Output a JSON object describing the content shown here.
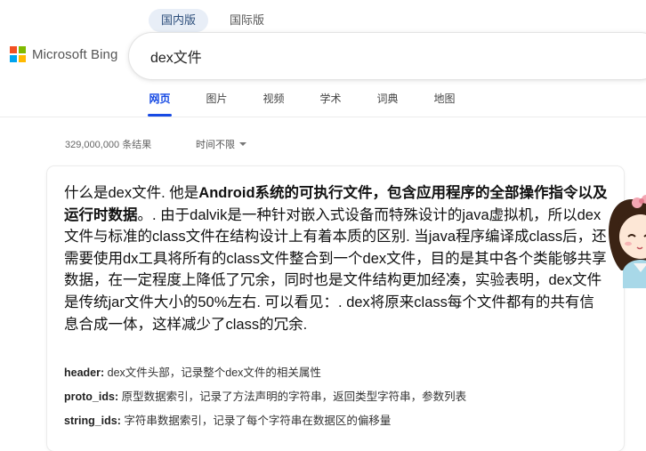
{
  "region_tabs": [
    {
      "label": "国内版",
      "active": true
    },
    {
      "label": "国际版",
      "active": false
    }
  ],
  "logo": {
    "text": "Microsoft Bing",
    "colors": [
      "#f25022",
      "#7fba00",
      "#00a4ef",
      "#ffb900"
    ]
  },
  "search": {
    "query": "dex文件"
  },
  "scopes": [
    {
      "label": "网页",
      "active": true
    },
    {
      "label": "图片",
      "active": false
    },
    {
      "label": "视频",
      "active": false
    },
    {
      "label": "学术",
      "active": false
    },
    {
      "label": "词典",
      "active": false
    },
    {
      "label": "地图",
      "active": false
    }
  ],
  "results_meta": {
    "count": "329,000,000 条结果",
    "time_filter": "时间不限"
  },
  "answer": {
    "part1": "什么是dex文件. 他是",
    "bold": "Android系统的可执行文件，包含应用程序的全部操作指令以及运行时数据",
    "part2": "。. 由于dalvik是一种针对嵌入式设备而特殊设计的java虚拟机，所以dex文件与标准的class文件在结构设计上有着本质的区别. 当java程序编译成class后，还需要使用dx工具将所有的class文件整合到一个dex文件，目的是其中各个类能够共享数据，在一定程度上降低了冗余，同时也是文件结构更加经凑，实验表明，dex文件是传统jar文件大小的50%左右. 可以看见：. dex将原来class每个文件都有的共有信息合成一体，这样减少了class的冗余."
  },
  "facts": [
    {
      "key": "header:",
      "value": " dex文件头部，记录整个dex文件的相关属性"
    },
    {
      "key": "proto_ids:",
      "value": " 原型数据索引，记录了方法声明的字符串，返回类型字符串，参数列表"
    },
    {
      "key": "string_ids:",
      "value": " 字符串数据索引，记录了每个字符串在数据区的偏移量"
    }
  ],
  "accent_color": "#174ae4"
}
